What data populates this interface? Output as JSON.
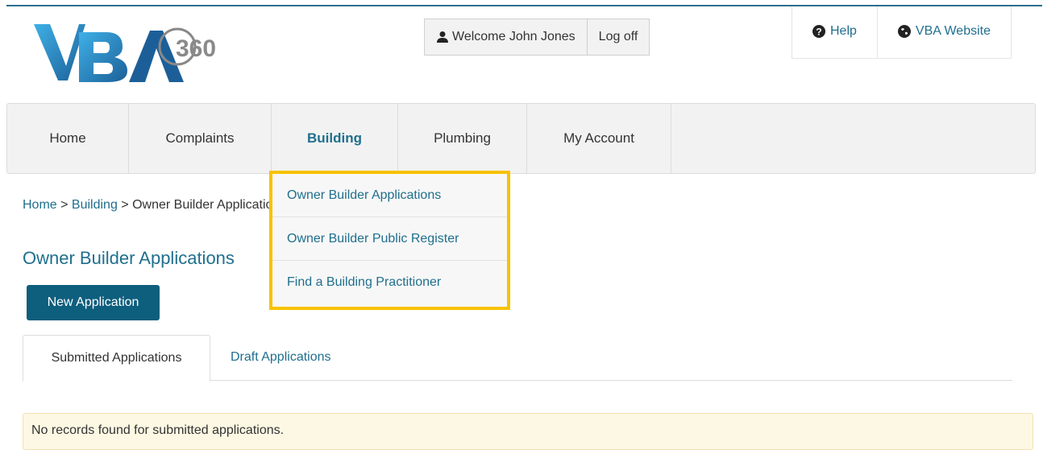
{
  "logo": {
    "text_primary": "VBA",
    "text_secondary": "360"
  },
  "user": {
    "welcome": "Welcome John Jones",
    "logoff": "Log off"
  },
  "toplinks": {
    "help": "Help",
    "website": "VBA Website"
  },
  "nav": {
    "items": [
      {
        "label": "Home"
      },
      {
        "label": "Complaints"
      },
      {
        "label": "Building"
      },
      {
        "label": "Plumbing"
      },
      {
        "label": "My Account"
      }
    ],
    "active": "Building"
  },
  "dropdown": {
    "items": [
      {
        "label": "Owner Builder Applications"
      },
      {
        "label": "Owner Builder Public Register"
      },
      {
        "label": "Find a Building Practitioner"
      }
    ]
  },
  "breadcrumb": {
    "home": "Home",
    "sep1": " > ",
    "building": "Building",
    "sep2": " > ",
    "current": "Owner Builder Applications"
  },
  "page": {
    "title": "Owner Builder Applications",
    "new_button": "New Application"
  },
  "tabs": {
    "submitted": "Submitted Applications",
    "draft": "Draft Applications"
  },
  "alert": {
    "message": "No records found for submitted applications."
  },
  "colors": {
    "accent": "#1f6f8d",
    "button": "#0e5e7d",
    "highlight": "#f7c200",
    "alert_bg": "#fcf8e3"
  }
}
